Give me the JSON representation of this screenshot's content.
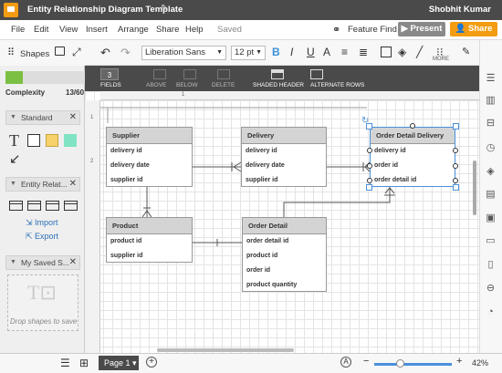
{
  "titlebar": {
    "doc_title": "Entity Relationship Diagram Template",
    "user_name": "Shobhit Kumar"
  },
  "menu": {
    "items": [
      "File",
      "Edit",
      "View",
      "Insert",
      "Arrange",
      "Share",
      "Help"
    ],
    "saved": "Saved",
    "feature_find": "Feature Find",
    "present": "Present",
    "share": "Share"
  },
  "toolbar": {
    "shapes_label": "Shapes",
    "font": "Liberation Sans",
    "font_size": "12 pt",
    "bold": "B",
    "italic": "I",
    "underline": "U",
    "more": "MORE"
  },
  "left_panel": {
    "complexity_label": "Complexity",
    "complexity_count": "13/60",
    "complexity_fraction": 0.217,
    "sections": {
      "standard": "Standard",
      "entity": "Entity Relat...",
      "saved": "My Saved S..."
    },
    "import": "Import",
    "export": "Export",
    "drop_text": "Drop shapes to save"
  },
  "erd_toolbar": {
    "fields_count": "3",
    "fields": "FIELDS",
    "above": "ABOVE",
    "below": "BELOW",
    "delete": "DELETE",
    "shaded_header": "SHADED HEADER",
    "alternate_rows": "ALTERNATE ROWS"
  },
  "entities": {
    "supplier": {
      "title": "Supplier",
      "rows": [
        "delivery id",
        "delivery date",
        "supplier id"
      ]
    },
    "delivery": {
      "title": "Delivery",
      "rows": [
        "delivery id",
        "delivery date",
        "supplier id"
      ]
    },
    "order_detail_delivery": {
      "title": "Order Detail Delivery",
      "rows": [
        "delivery id",
        "order id",
        "order detail id"
      ]
    },
    "product": {
      "title": "Product",
      "rows": [
        "product id",
        "supplier id"
      ]
    },
    "order_detail": {
      "title": "Order Detail",
      "rows": [
        "order detail id",
        "product id",
        "order id",
        "product quantity"
      ]
    }
  },
  "ruler": {
    "top": "1",
    "left_1": "1",
    "left_2": "2"
  },
  "bottom": {
    "page": "Page 1",
    "zoom": "42%"
  }
}
